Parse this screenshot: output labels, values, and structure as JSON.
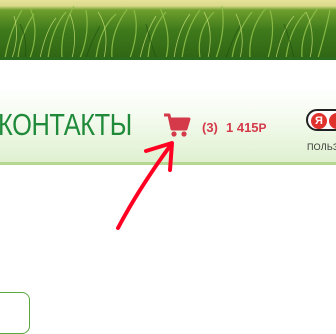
{
  "nav": {
    "contacts_label": "КОНТАКТЫ"
  },
  "cart": {
    "icon": "shopping-cart-icon",
    "count_label": "(3)",
    "total_label": "1 415",
    "currency_label": "Р",
    "color": "#d43a4a"
  },
  "yandex": {
    "logo_letter": "Я",
    "caption": "ПОЛЬЗОВ"
  },
  "colors": {
    "nav_text": "#1f8a3a",
    "menu_border": "#b4d88f",
    "banner_border": "#2c6b1e",
    "annotation_arrow": "#ff0022"
  }
}
